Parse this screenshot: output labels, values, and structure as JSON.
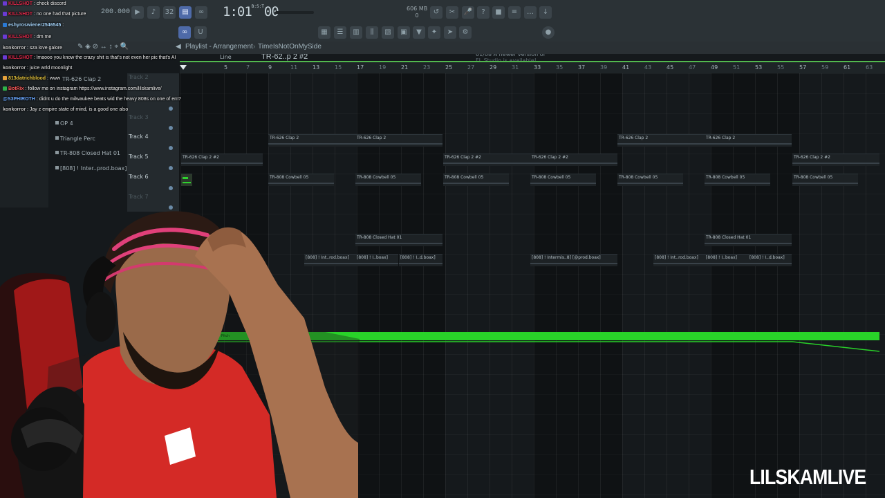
{
  "toolbar": {
    "tempo": "200.000",
    "time": "1:01",
    "time_ms": "00",
    "time_sup": "B:S:T",
    "memory": "606 MB",
    "memory_sub": "0",
    "snap_mode": "Line",
    "pattern_selector": "TR-62..p 2 #2",
    "news_line1": "01/08  A newer version of",
    "news_line2": "FL Studio is available!"
  },
  "playlist": {
    "title": "Playlist - Arrangement",
    "project": "TimeIsNotOnMySide",
    "ruler_ticks": [
      "5",
      "7",
      "9",
      "11",
      "13",
      "15",
      "17",
      "19",
      "21",
      "23",
      "25",
      "27",
      "29",
      "31",
      "33",
      "35",
      "37",
      "39",
      "41",
      "43",
      "45",
      "47",
      "49",
      "51",
      "53",
      "55",
      "57",
      "59",
      "61",
      "63",
      "65"
    ],
    "tracks": [
      {
        "name": "Track 2",
        "dim": true
      },
      {
        "name": "Track 3",
        "dim": true
      },
      {
        "name": "Track 4",
        "dim": false
      },
      {
        "name": "Track 5",
        "dim": false
      },
      {
        "name": "Track 6",
        "dim": false
      },
      {
        "name": "Track 7",
        "dim": true
      }
    ],
    "patterns": [
      "OP 4",
      "Triangle Perc",
      "TR-808 Closed Hat 01",
      "[808] ! Inter..prod.boax]"
    ],
    "pattern_top": "TR-626 Clap 2",
    "clips": [
      {
        "label": "TR-626 Clap 2"
      },
      {
        "label": "TR-626 Clap 2"
      },
      {
        "label": "TR-626 Clap 2"
      },
      {
        "label": "TR-626 Clap 2"
      },
      {
        "label": "TR-626 Clap 2 #2"
      },
      {
        "label": "TR-626 Clap 2 #2"
      },
      {
        "label": "TR-626 Clap 2 #2"
      },
      {
        "label": "TR-626 Clap 2 #2"
      },
      {
        "label": "TR-808 Cowbell 05"
      },
      {
        "label": "TR-808 Cowbell 05"
      },
      {
        "label": "TR-808 Cowbell 05"
      },
      {
        "label": "TR-808 Cowbell 05"
      },
      {
        "label": "TR-808 Cowbell 05"
      },
      {
        "label": "TR-808 Cowbell 05"
      },
      {
        "label": "TR-808 Cowbell 05"
      },
      {
        "label": "TR-808 Closed Hat 01"
      },
      {
        "label": "TR-808 Closed Hat 01"
      },
      {
        "label": "[808] ! Int..rod.boax]"
      },
      {
        "label": "[808] ! I..boax]"
      },
      {
        "label": "[808] ! I..d.boax]"
      },
      {
        "label": "[808] ! Intermis..8] [@prod.boax]"
      },
      {
        "label": "[808] ! Int..rod.boax]"
      },
      {
        "label": "[808] ! I..boax]"
      },
      {
        "label": "[808] ! I..d.boax]"
      }
    ],
    "automation_label": "Pitch"
  },
  "chat": [
    {
      "user": "KILLSHOT",
      "text": "check discord",
      "color": "#e0294b"
    },
    {
      "user": "KILLSHOT",
      "text": "no one had that picture",
      "color": "#e0294b"
    },
    {
      "user": "eshyroswiener2546545",
      "text": "",
      "color": "#a8d8ff"
    },
    {
      "user": "KILLSHOT",
      "text": "dm me",
      "color": "#e0294b"
    },
    {
      "user": "konkorror",
      "text": "sza love galore",
      "color": "#c6c6c6"
    },
    {
      "user": "KILLSHOT",
      "text": "lmaooo you know the crazy shit is that's not even her pic that's AI",
      "color": "#e0294b"
    },
    {
      "user": "konkorror",
      "text": "juice wrld moonlight",
      "color": "#c6c6c6"
    },
    {
      "user": "813datrichblood",
      "text": "www",
      "color": "#e6c43c"
    },
    {
      "user": "BotRix",
      "text": "follow me on instagram https://www.instagram.com/lilskamlive/",
      "color": "#ff5a5a"
    },
    {
      "user": "@S3PHIROTH",
      "text": "didnt u do the milwaukee beats wid the heavy 808s on one of em?",
      "color": "#6aa8ff"
    },
    {
      "user": "konkorror",
      "text": "Jay z empire state of mind, is a good one also",
      "color": "#c6c6c6"
    }
  ],
  "watermark": "LILSKAMLIVE",
  "colors": {
    "accent_green": "#29d229",
    "toolbar_bg": "#2b3236",
    "grid_bg": "#15191c",
    "jersey_red": "#d42a26"
  }
}
